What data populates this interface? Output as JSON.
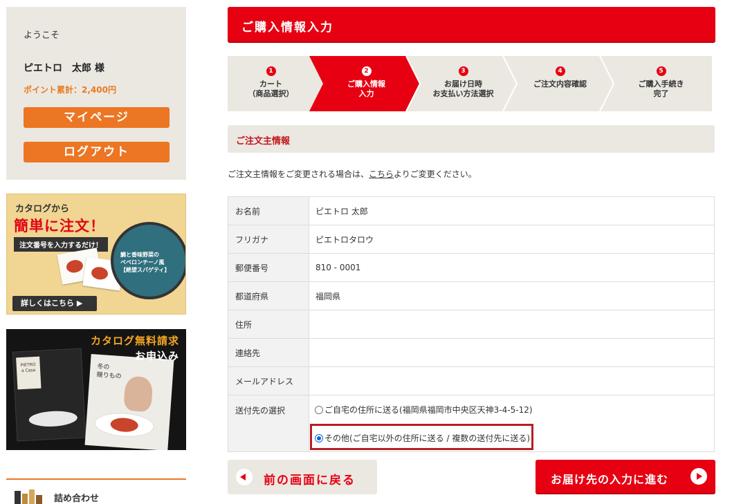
{
  "sidebar": {
    "welcome": "ようこそ",
    "user_name": "ピエトロ　太郎 様",
    "points": "ポイント累計：2,400円",
    "mypage_label": "マイページ",
    "logout_label": "ログアウト",
    "banner_order": {
      "line1": "カタログから",
      "line2": "簡単に注文！",
      "tag": "注文番号を入力するだけ！",
      "product_text": "鯛と香味野菜の\nペペロンチーノ風\n【絶望スパゲティ】",
      "button": "詳しくはこちら ▶"
    },
    "banner_request": {
      "line1": "カタログ無料請求",
      "line2": "お申込み",
      "brand": "PIETRO\na Casa",
      "catalog_text": "冬の\n贈りもの"
    },
    "giftset_label": "詰め合わせ"
  },
  "main": {
    "title": "ご購入情報入力",
    "steps": [
      {
        "num": "1",
        "label": "カート\n（商品選択）"
      },
      {
        "num": "2",
        "label": "ご購入情報\n入力"
      },
      {
        "num": "3",
        "label": "お届け日時\nお支払い方法選択"
      },
      {
        "num": "4",
        "label": "ご注文内容確認"
      },
      {
        "num": "5",
        "label": "ご購入手続き\n完了"
      }
    ],
    "active_step": 2,
    "section_title": "ご注文主情報",
    "notice_before": "ご注文主情報をご変更される場合は、",
    "notice_link": "こちら",
    "notice_after": "よりご変更ください。",
    "rows": [
      {
        "label": "お名前",
        "value": "ピエトロ 太郎"
      },
      {
        "label": "フリガナ",
        "value": "ピエトロタロウ"
      },
      {
        "label": "郵便番号",
        "value": "810 - 0001"
      },
      {
        "label": "都道府県",
        "value": "福岡県"
      },
      {
        "label": "住所",
        "value": ""
      },
      {
        "label": "連絡先",
        "value": ""
      },
      {
        "label": "メールアドレス",
        "value": ""
      }
    ],
    "shipping": {
      "label": "送付先の選択",
      "option_home": "ご自宅の住所に送る(福岡県福岡市中央区天神3-4-5-12)",
      "option_other": "その他(ご自宅以外の住所に送る / 複数の送付先に送る)",
      "selected": "other"
    },
    "back_label": "前の画面に戻る",
    "next_label": "お届け先の入力に進む"
  },
  "colors": {
    "brand_red": "#e60012",
    "accent_orange": "#ec7623",
    "panel_beige": "#ebe8e2"
  }
}
